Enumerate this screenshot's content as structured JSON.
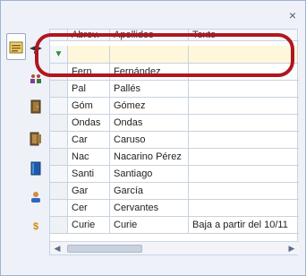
{
  "window": {
    "close_glyph": "×"
  },
  "sidebar": {
    "items": [
      {
        "name": "list-view-icon"
      },
      {
        "name": "group-icon"
      },
      {
        "name": "door-icon"
      },
      {
        "name": "door-exit-icon"
      },
      {
        "name": "book-icon"
      },
      {
        "name": "user-icon"
      },
      {
        "name": "money-icon",
        "glyph": "$"
      }
    ]
  },
  "grid": {
    "headers": [
      "Abrev.",
      "Apellidos",
      "Texto"
    ],
    "filter_icon": "filter-icon",
    "rows": [
      [
        "Fern",
        "Fernández",
        ""
      ],
      [
        "Pal",
        "Pallés",
        ""
      ],
      [
        "Góm",
        "Gómez",
        ""
      ],
      [
        "Ondas",
        "Ondas",
        ""
      ],
      [
        "Car",
        "Caruso",
        ""
      ],
      [
        "Nac",
        "Nacarino Pérez",
        ""
      ],
      [
        "Santi",
        "Santiago",
        ""
      ],
      [
        "Gar",
        "García",
        ""
      ],
      [
        "Cer",
        "Cervantes",
        ""
      ],
      [
        "Curie",
        "Curie",
        "Baja a partir del 10/11"
      ]
    ]
  },
  "scrollbar": {
    "left_glyph": "◀",
    "right_glyph": "▶"
  },
  "colors": {
    "accent": "#b0161f",
    "filter_row": "#fff7dc",
    "frame": "#eef2f8"
  }
}
